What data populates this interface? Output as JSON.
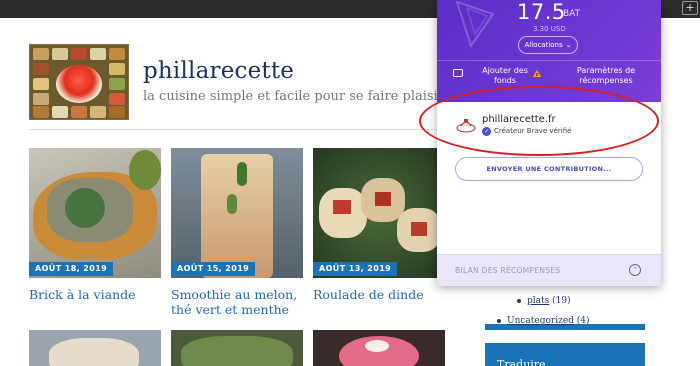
{
  "browser": {
    "extension_button": "+"
  },
  "blog": {
    "title": "phillarecette",
    "tagline": "la cuisine simple et facile pour se faire plaisir au quotidien"
  },
  "posts": [
    {
      "date": "AOÛT 18, 2019",
      "title": "Brick à la viande"
    },
    {
      "date": "AOÛT 15, 2019",
      "title": "Smoothie au melon, thé vert et menthe"
    },
    {
      "date": "AOÛT 13, 2019",
      "title": "Roulade de dinde"
    }
  ],
  "sidebar": {
    "categories": [
      {
        "label": "plats",
        "count": "(19)"
      },
      {
        "label": "Uncategorized",
        "count": "(4)"
      }
    ],
    "widget_title": "Traduire"
  },
  "brave": {
    "balance": "17.5",
    "currency": "BAT",
    "usd": "3.30 USD",
    "allocations_label": "Allocations",
    "add_funds_label": "Ajouter des fonds",
    "settings_label": "Paramètres de récompenses",
    "publisher_name": "phillarecette.fr",
    "verified_label": "Créateur Brave vérifié",
    "contribute_label": "ENVOYER UNE CONTRIBUTION...",
    "summary_label": "BILAN DES RÉCOMPENSES"
  },
  "colors": {
    "brave_purple": "#6a35d0",
    "badge_blue": "#1b73b7",
    "link_blue": "#1e6fae",
    "annotation_red": "#d81e1e"
  }
}
